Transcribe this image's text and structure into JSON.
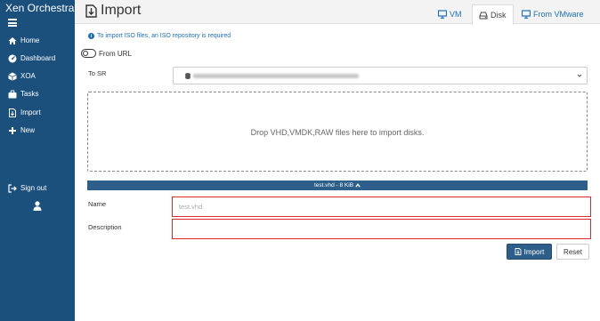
{
  "app": {
    "title": "Xen Orchestra"
  },
  "sidebar": {
    "items": [
      {
        "label": "Home",
        "icon": "home-icon"
      },
      {
        "label": "Dashboard",
        "icon": "dashboard-icon"
      },
      {
        "label": "XOA",
        "icon": "xoa-cube-icon"
      },
      {
        "label": "Tasks",
        "icon": "tasks-icon"
      },
      {
        "label": "Import",
        "icon": "import-icon"
      },
      {
        "label": "New",
        "icon": "plus-icon"
      }
    ],
    "signout": {
      "label": "Sign out",
      "icon": "sign-out-icon"
    },
    "user_icon": "user-icon"
  },
  "header": {
    "title": "Import",
    "tabs": [
      {
        "label": "VM",
        "icon": "monitor-icon"
      },
      {
        "label": "Disk",
        "icon": "disk-icon"
      },
      {
        "label": "From VMware",
        "icon": "monitor-icon"
      }
    ],
    "active_tab": "Disk"
  },
  "main": {
    "info": "To import ISO files, an ISO repository is required",
    "from_url": {
      "label": "From URL",
      "checked": false
    },
    "sr": {
      "label": "To SR"
    },
    "dropzone": {
      "text": "Drop VHD,VMDK,RAW files here to import disks."
    },
    "file": {
      "summary": "test.vhd - 8 KiB"
    },
    "name": {
      "label": "Name",
      "placeholder": "test.vhd",
      "value": ""
    },
    "description": {
      "label": "Description",
      "value": ""
    },
    "buttons": {
      "import": "Import",
      "reset": "Reset"
    }
  },
  "colors": {
    "sidebar": "#1b4f7c",
    "primary": "#2d5f8a",
    "link": "#1f6fb5",
    "error_border": "#e0282d"
  }
}
